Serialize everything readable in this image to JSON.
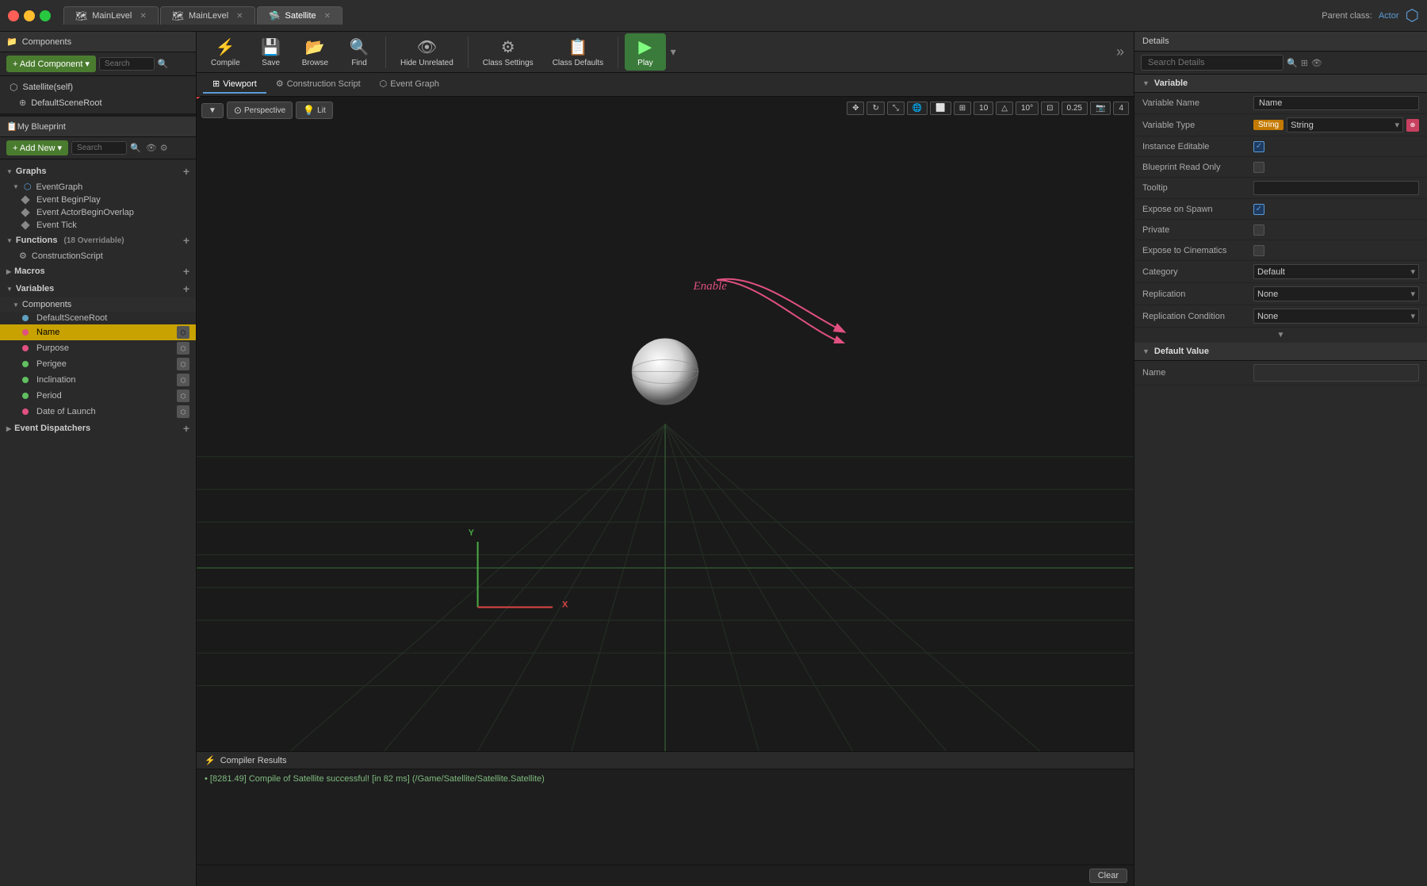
{
  "titlebar": {
    "tabs": [
      {
        "label": "MainLevel",
        "icon": "🗺",
        "active": false
      },
      {
        "label": "MainLevel",
        "icon": "🗺",
        "active": false
      },
      {
        "label": "Satellite",
        "icon": "🛸",
        "active": true
      }
    ],
    "parent_class_label": "Parent class:",
    "parent_class_value": "Actor"
  },
  "toolbar": {
    "compile_label": "Compile",
    "save_label": "Save",
    "browse_label": "Browse",
    "find_label": "Find",
    "hide_unrelated_label": "Hide Unrelated",
    "class_settings_label": "Class Settings",
    "class_defaults_label": "Class Defaults",
    "play_label": "Play"
  },
  "editor_tabs": [
    {
      "label": "Viewport",
      "icon": "⊞",
      "active": true
    },
    {
      "label": "Construction Script",
      "icon": "⚙",
      "active": false
    },
    {
      "label": "Event Graph",
      "icon": "⬡",
      "active": false
    }
  ],
  "viewport": {
    "perspective_label": "Perspective",
    "lit_label": "Lit",
    "num1": "10",
    "num2": "10°",
    "num3": "0.25",
    "num4": "4",
    "axis_y": "Y",
    "axis_x": "X"
  },
  "left_panel": {
    "components_title": "Components",
    "add_component_label": "+ Add Component",
    "add_component_arrow": "▾",
    "search_placeholder": "Search",
    "satellite_item": "Satellite(self)",
    "default_scene_root": "DefaultSceneRoot",
    "my_blueprint_title": "My Blueprint",
    "add_new_label": "+ Add New",
    "add_new_arrow": "▾",
    "bp_search_placeholder": "Search",
    "graphs_label": "Graphs",
    "event_graph_label": "EventGraph",
    "event_begin_play": "Event BeginPlay",
    "event_actor_begin_overlap": "Event ActorBeginOverlap",
    "event_tick": "Event Tick",
    "functions_label": "Functions",
    "functions_count": "(18 Overridable)",
    "construction_script": "ConstructionScript",
    "macros_label": "Macros",
    "variables_label": "Variables",
    "components_vars_label": "Components",
    "default_scene_root_var": "DefaultSceneRoot",
    "name_var": "Name",
    "purpose_var": "Purpose",
    "perigee_var": "Perigee",
    "inclination_var": "Inclination",
    "period_var": "Period",
    "date_of_launch_var": "Date of Launch",
    "event_dispatchers_label": "Event Dispatchers"
  },
  "details_panel": {
    "title": "Details",
    "search_placeholder": "Search Details",
    "variable_section": "Variable",
    "variable_name_label": "Variable Name",
    "variable_name_value": "Name",
    "variable_type_label": "Variable Type",
    "variable_type_value": "String",
    "instance_editable_label": "Instance Editable",
    "blueprint_read_only_label": "Blueprint Read Only",
    "tooltip_label": "Tooltip",
    "expose_on_spawn_label": "Expose on Spawn",
    "private_label": "Private",
    "expose_to_cinematics_label": "Expose to Cinematics",
    "category_label": "Category",
    "category_value": "Default",
    "replication_label": "Replication",
    "replication_value": "None",
    "replication_condition_label": "Replication Condition",
    "replication_condition_value": "None",
    "default_value_section": "Default Value",
    "name_default_label": "Name"
  },
  "compiler": {
    "title": "Compiler Results",
    "message": "• [8281.49] Compile of Satellite successful! [in 82 ms] (/Game/Satellite/Satellite.Satellite)",
    "clear_label": "Clear"
  },
  "annotation": {
    "enable_text": "Enable"
  },
  "colors": {
    "name_dot": "#e05080",
    "purpose_dot": "#e05080",
    "perigee_dot": "#60c060",
    "inclination_dot": "#60c060",
    "period_dot": "#60c060",
    "date_dot": "#e05080",
    "string_badge": "#c47a00"
  }
}
